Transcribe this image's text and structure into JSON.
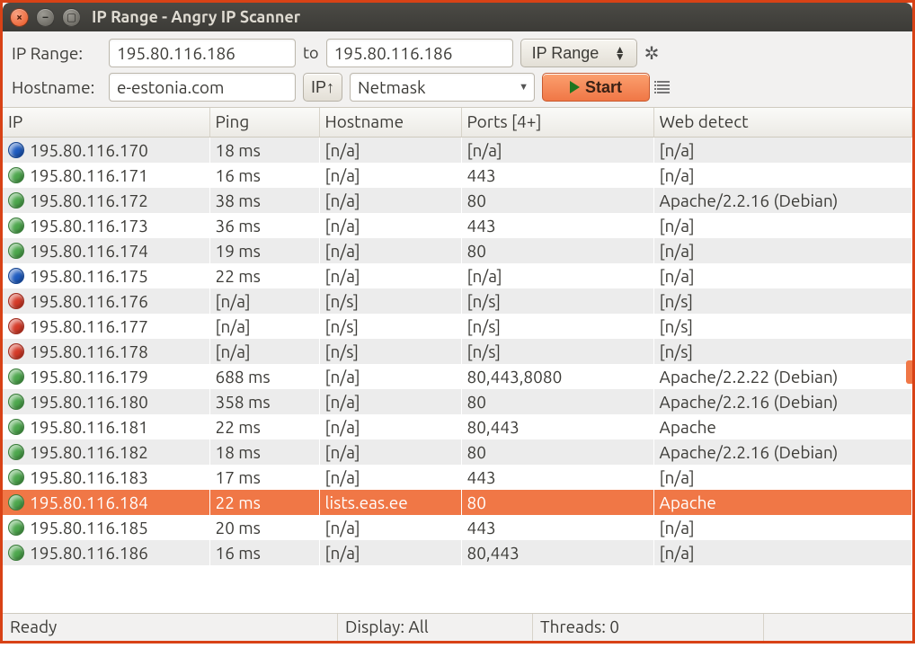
{
  "window": {
    "title": "IP Range - Angry IP Scanner"
  },
  "toolbar": {
    "range_label": "IP Range:",
    "to_label": "to",
    "ip_from": "195.80.116.186",
    "ip_to": "195.80.116.186",
    "feeder_label": "IP Range",
    "hostname_label": "Hostname:",
    "hostname_value": "e-estonia.com",
    "ip_up_label": "IP↑",
    "netmask_label": "Netmask",
    "start_label": "Start"
  },
  "columns": {
    "ip": "IP",
    "ping": "Ping",
    "hostname": "Hostname",
    "ports": "Ports [4+]",
    "web": "Web detect"
  },
  "rows": [
    {
      "status": "blue",
      "ip": "195.80.116.170",
      "ping": "18 ms",
      "hostname": "[n/a]",
      "ports": "[n/a]",
      "web": "[n/a]",
      "selected": false
    },
    {
      "status": "green",
      "ip": "195.80.116.171",
      "ping": "16 ms",
      "hostname": "[n/a]",
      "ports": "443",
      "web": "[n/a]",
      "selected": false
    },
    {
      "status": "green",
      "ip": "195.80.116.172",
      "ping": "38 ms",
      "hostname": "[n/a]",
      "ports": "80",
      "web": "Apache/2.2.16 (Debian)",
      "selected": false
    },
    {
      "status": "green",
      "ip": "195.80.116.173",
      "ping": "36 ms",
      "hostname": "[n/a]",
      "ports": "443",
      "web": "[n/a]",
      "selected": false
    },
    {
      "status": "green",
      "ip": "195.80.116.174",
      "ping": "19 ms",
      "hostname": "[n/a]",
      "ports": "80",
      "web": "[n/a]",
      "selected": false
    },
    {
      "status": "blue",
      "ip": "195.80.116.175",
      "ping": "22 ms",
      "hostname": "[n/a]",
      "ports": "[n/a]",
      "web": "[n/a]",
      "selected": false
    },
    {
      "status": "red",
      "ip": "195.80.116.176",
      "ping": "[n/a]",
      "hostname": "[n/s]",
      "ports": "[n/s]",
      "web": "[n/s]",
      "selected": false
    },
    {
      "status": "red",
      "ip": "195.80.116.177",
      "ping": "[n/a]",
      "hostname": "[n/s]",
      "ports": "[n/s]",
      "web": "[n/s]",
      "selected": false
    },
    {
      "status": "red",
      "ip": "195.80.116.178",
      "ping": "[n/a]",
      "hostname": "[n/s]",
      "ports": "[n/s]",
      "web": "[n/s]",
      "selected": false
    },
    {
      "status": "green",
      "ip": "195.80.116.179",
      "ping": "688 ms",
      "hostname": "[n/a]",
      "ports": "80,443,8080",
      "web": "Apache/2.2.22 (Debian)",
      "selected": false
    },
    {
      "status": "green",
      "ip": "195.80.116.180",
      "ping": "358 ms",
      "hostname": "[n/a]",
      "ports": "80",
      "web": "Apache/2.2.16 (Debian)",
      "selected": false
    },
    {
      "status": "green",
      "ip": "195.80.116.181",
      "ping": "22 ms",
      "hostname": "[n/a]",
      "ports": "80,443",
      "web": "Apache",
      "selected": false
    },
    {
      "status": "green",
      "ip": "195.80.116.182",
      "ping": "18 ms",
      "hostname": "[n/a]",
      "ports": "80",
      "web": "Apache/2.2.16 (Debian)",
      "selected": false
    },
    {
      "status": "green",
      "ip": "195.80.116.183",
      "ping": "17 ms",
      "hostname": "[n/a]",
      "ports": "443",
      "web": "[n/a]",
      "selected": false
    },
    {
      "status": "green",
      "ip": "195.80.116.184",
      "ping": "22 ms",
      "hostname": "lists.eas.ee",
      "ports": "80",
      "web": "Apache",
      "selected": true
    },
    {
      "status": "green",
      "ip": "195.80.116.185",
      "ping": "20 ms",
      "hostname": "[n/a]",
      "ports": "443",
      "web": "[n/a]",
      "selected": false
    },
    {
      "status": "green",
      "ip": "195.80.116.186",
      "ping": "16 ms",
      "hostname": "[n/a]",
      "ports": "80,443",
      "web": "[n/a]",
      "selected": false
    }
  ],
  "status": {
    "ready": "Ready",
    "display": "Display: All",
    "threads": "Threads: 0"
  }
}
